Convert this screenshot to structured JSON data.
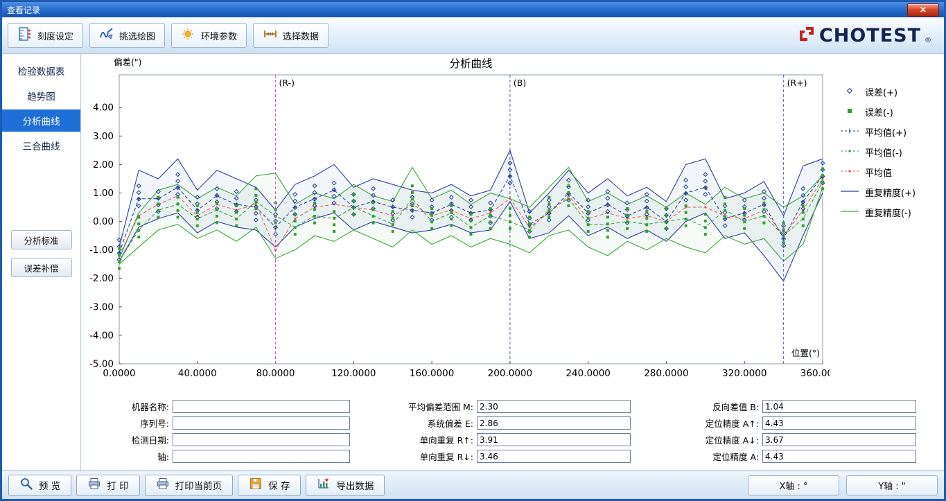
{
  "window": {
    "title": "查看记录",
    "close_glyph": "×"
  },
  "toolbar": {
    "buttons": [
      {
        "label": "刻度设定",
        "icon": "scale-settings-icon"
      },
      {
        "label": "挑选绘图",
        "icon": "pick-plot-icon"
      },
      {
        "label": "环境参数",
        "icon": "environment-params-icon"
      },
      {
        "label": "选择数据",
        "icon": "select-data-icon"
      }
    ],
    "brand": {
      "text": "CHOTEST",
      "reg": "®",
      "text_color": "#15234e",
      "logo_color": "#c62222"
    }
  },
  "sidebar": {
    "tabs": [
      {
        "label": "检验数据表",
        "active": false
      },
      {
        "label": "趋势图",
        "active": false
      },
      {
        "label": "分析曲线",
        "active": true
      },
      {
        "label": "三合曲线",
        "active": false
      }
    ],
    "buttons": [
      {
        "label": "分析标准"
      },
      {
        "label": "误差补偿"
      }
    ],
    "active_color": "#1e6fd6"
  },
  "chart_data": {
    "type": "line",
    "title": "分析曲线",
    "ylabel": "偏差(\")",
    "xlabel": "位置(°)",
    "xlim": [
      0,
      360
    ],
    "ylim": [
      -5,
      5.15
    ],
    "xticks": [
      0,
      40,
      80,
      120,
      160,
      200,
      240,
      280,
      320,
      360
    ],
    "yticks": [
      4,
      3,
      2,
      1,
      0,
      -1,
      -2,
      -3,
      -4,
      -5
    ],
    "legend_position": "right",
    "grid": false,
    "ref_lines": [
      {
        "x": 80,
        "label": "(R-)",
        "color": "#c455c4"
      },
      {
        "x": 200,
        "label": "(B)",
        "color": "#45628f"
      },
      {
        "x": 340,
        "label": "(R+)",
        "color": "#4a66cc"
      }
    ],
    "x": [
      0,
      10,
      20,
      30,
      40,
      50,
      60,
      70,
      80,
      90,
      100,
      110,
      120,
      130,
      140,
      150,
      160,
      170,
      180,
      190,
      200,
      210,
      220,
      230,
      240,
      250,
      260,
      270,
      280,
      290,
      300,
      310,
      320,
      330,
      340,
      350,
      360
    ],
    "series": [
      {
        "name": "误差(+)",
        "type": "scatter",
        "marker": "diamond",
        "color": "#1f3a93",
        "spread": 0.35,
        "values": [
          -1.0,
          0.9,
          0.7,
          1.3,
          0.5,
          0.8,
          0.7,
          0.4,
          -0.1,
          0.6,
          0.9,
          1.0,
          0.6,
          0.8,
          0.4,
          0.5,
          0.4,
          0.5,
          0.4,
          0.3,
          1.7,
          0.0,
          0.4,
          1.1,
          0.4,
          0.7,
          0.3,
          0.6,
          0.1,
          1.1,
          1.3,
          0.2,
          0.4,
          0.7,
          -0.5,
          0.8,
          1.7
        ]
      },
      {
        "name": "误差(-)",
        "type": "scatter",
        "marker": "square",
        "color": "#2fa12f",
        "spread": 0.35,
        "values": [
          -1.3,
          -0.2,
          0.5,
          0.5,
          0.2,
          0.3,
          0.2,
          0.8,
          0.3,
          -0.1,
          0.3,
          0.0,
          0.6,
          0.3,
          0.0,
          0.9,
          0.1,
          0.2,
          -0.1,
          0.1,
          0.1,
          -0.2,
          0.5,
          0.9,
          0.0,
          -0.2,
          0.1,
          0.0,
          0.1,
          0.2,
          -0.1,
          0.5,
          0.1,
          0.3,
          -0.4,
          0.2,
          1.5
        ]
      },
      {
        "name": "平均值(+)",
        "type": "dashed",
        "marker": "plus",
        "color": "#1f3a93",
        "values": [
          -1.1,
          0.8,
          0.8,
          1.2,
          0.4,
          0.9,
          0.6,
          0.5,
          -0.2,
          0.5,
          0.8,
          1.1,
          0.5,
          0.7,
          0.5,
          0.4,
          0.3,
          0.6,
          0.3,
          0.4,
          1.6,
          -0.1,
          0.3,
          1.0,
          0.3,
          0.6,
          0.2,
          0.5,
          0.0,
          1.0,
          1.2,
          0.1,
          0.3,
          0.6,
          -0.6,
          0.7,
          1.6
        ]
      },
      {
        "name": "平均值(-)",
        "type": "dashed",
        "marker": "dot",
        "color": "#2fa12f",
        "values": [
          -1.4,
          -0.3,
          0.4,
          0.6,
          0.1,
          0.4,
          0.1,
          0.7,
          0.2,
          -0.2,
          0.2,
          0.1,
          0.5,
          0.2,
          -0.1,
          0.8,
          0.0,
          0.3,
          -0.2,
          0.2,
          0.0,
          -0.3,
          0.4,
          0.8,
          -0.1,
          -0.1,
          0.0,
          -0.1,
          0.0,
          0.1,
          -0.2,
          0.4,
          0.0,
          0.2,
          -0.5,
          0.1,
          1.4
        ]
      },
      {
        "name": "平均值",
        "type": "dashed",
        "marker": "dot",
        "color": "#e05858",
        "values": [
          -1.2,
          0.2,
          0.6,
          0.9,
          0.2,
          0.6,
          0.4,
          0.6,
          -1.0,
          0.1,
          0.5,
          0.6,
          0.5,
          0.4,
          0.2,
          0.6,
          0.2,
          0.4,
          0.1,
          0.3,
          0.8,
          -0.2,
          0.3,
          0.9,
          0.1,
          0.3,
          0.1,
          0.2,
          0.0,
          0.5,
          0.5,
          0.2,
          0.1,
          0.4,
          -0.5,
          0.4,
          1.5
        ]
      },
      {
        "name": "重复精度(+)",
        "type": "envelope",
        "color": "#2a3f9e",
        "fill": "rgba(70,110,175,0.07)",
        "values": [
          -0.9,
          1.8,
          1.5,
          2.2,
          1.1,
          1.8,
          1.5,
          1.2,
          0.4,
          1.3,
          1.6,
          2.0,
          1.2,
          1.5,
          1.3,
          1.1,
          1.0,
          1.3,
          0.9,
          1.1,
          2.5,
          0.3,
          1.0,
          1.8,
          1.0,
          1.5,
          0.9,
          1.2,
          0.7,
          2.0,
          2.2,
          0.8,
          1.0,
          1.4,
          0.2,
          1.95,
          2.2
        ],
        "values2": [
          -1.4,
          -0.2,
          0.1,
          0.3,
          -0.4,
          0.0,
          -0.2,
          -0.3,
          -0.9,
          -0.2,
          0.1,
          0.3,
          -0.3,
          0.0,
          -0.2,
          -0.4,
          -0.3,
          -0.1,
          -0.4,
          -0.3,
          0.7,
          -0.6,
          -0.4,
          0.2,
          -0.5,
          -0.2,
          -0.6,
          -0.3,
          -0.7,
          0.0,
          0.3,
          -0.6,
          -0.4,
          -1.2,
          -2.1,
          -0.5,
          1.0
        ]
      },
      {
        "name": "重复精度(-)",
        "type": "envelope",
        "color": "#3aa83a",
        "fill": "rgba(80,165,80,0.05)",
        "values": [
          -1.3,
          0.3,
          1.1,
          1.3,
          0.8,
          1.2,
          0.9,
          1.6,
          1.7,
          0.6,
          1.0,
          0.8,
          1.3,
          0.9,
          0.7,
          1.9,
          0.8,
          1.1,
          0.6,
          1.0,
          0.8,
          0.5,
          1.2,
          1.9,
          0.7,
          1.0,
          0.6,
          0.9,
          0.5,
          1.0,
          0.6,
          1.2,
          0.8,
          1.0,
          0.5,
          0.9,
          1.6
        ],
        "values2": [
          -1.5,
          -0.9,
          -0.3,
          -0.1,
          -0.6,
          -0.3,
          -0.7,
          -0.2,
          -1.3,
          -1.0,
          -0.5,
          -0.7,
          -0.3,
          -0.6,
          -0.9,
          -0.3,
          -0.8,
          -0.5,
          -0.9,
          -0.6,
          -0.8,
          -1.1,
          -0.5,
          -0.3,
          -0.9,
          -1.2,
          -0.7,
          -1.0,
          -0.6,
          -0.9,
          -1.1,
          -0.5,
          -0.8,
          -0.6,
          -1.4,
          -0.8,
          1.2
        ]
      }
    ]
  },
  "form": {
    "left": [
      {
        "label": "机器名称:",
        "value": ""
      },
      {
        "label": "序列号:",
        "value": ""
      },
      {
        "label": "检测日期:",
        "value": ""
      },
      {
        "label": "轴:",
        "value": ""
      }
    ],
    "middle": [
      {
        "label": "平均偏差范围 M:",
        "value": "2.30"
      },
      {
        "label": "系统偏差 E:",
        "value": "2.86"
      },
      {
        "label": "单向重复 R↑:",
        "value": "3.91"
      },
      {
        "label": "单向重复 R↓:",
        "value": "3.46"
      }
    ],
    "right": [
      {
        "label": "反向差值 B:",
        "value": "1.04"
      },
      {
        "label": "定位精度 A↑:",
        "value": "4.43"
      },
      {
        "label": "定位精度 A↓:",
        "value": "3.67"
      },
      {
        "label": "定位精度 A:",
        "value": "4.43"
      }
    ]
  },
  "bottom_toolbar": {
    "buttons": [
      {
        "label": "预 览",
        "icon": "magnifier-icon"
      },
      {
        "label": "打 印",
        "icon": "printer-icon"
      },
      {
        "label": "打印当前页",
        "icon": "printer-icon"
      },
      {
        "label": "保 存",
        "icon": "save-icon"
      },
      {
        "label": "导出数据",
        "icon": "export-icon"
      }
    ],
    "axis_buttons": [
      {
        "label": "X轴 : °"
      },
      {
        "label": "Y轴 : \""
      }
    ]
  }
}
